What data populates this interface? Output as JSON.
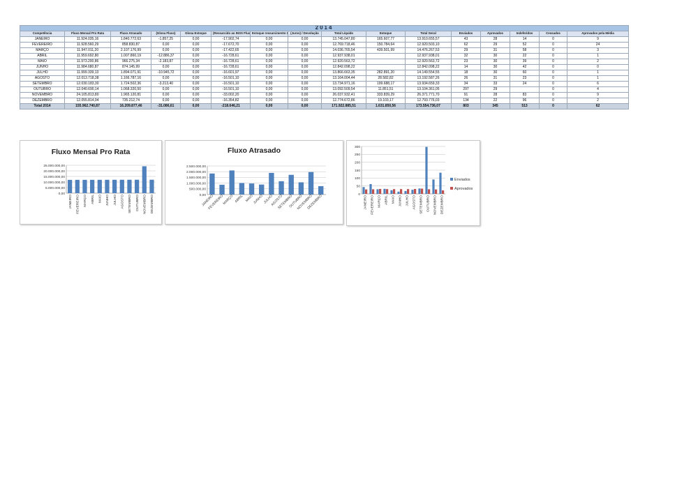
{
  "table": {
    "year": "2014",
    "headers": [
      "Competência",
      "Fluxo Mensal Pro Rata",
      "Fluxo Atrasado",
      "(Glosa Fluxo)",
      "Glosa Estoque",
      "(Ressarcido ao INSS Fluxo)",
      "Estoque ressarcimento INSS",
      "(Juros) / Devolução",
      "Total Líquido",
      "Estoque",
      "Total Geral",
      "Enviados",
      "Aprovados",
      "Indeferidos",
      "Cessados",
      "Aprovados pela Média"
    ],
    "rows": [
      [
        "JANEIRO",
        "11.924.035,16",
        "1.840.772,63",
        "-1.857,25",
        "0,00",
        "-17.902,74",
        "0,00",
        "0,00",
        "13.745.047,80",
        "165.607,77",
        "13.910.655,57",
        "43",
        "28",
        "14",
        "0",
        "9"
      ],
      [
        "FEVEREIRO",
        "11.928.560,29",
        "858.830,87",
        "0,00",
        "0,00",
        "-17.672,70",
        "0,00",
        "0,00",
        "12.769.718,46",
        "150.784,64",
        "12.920.503,10",
        "62",
        "29",
        "52",
        "0",
        "24"
      ],
      [
        "MARÇO",
        "11.947.011,20",
        "2.107.176,99",
        "0,00",
        "0,00",
        "-17.422,65",
        "0,00",
        "0,00",
        "14.036.765,54",
        "439.501,99",
        "14.476.267,53",
        "29",
        "31",
        "58",
        "0",
        "3"
      ],
      [
        "ABRIL",
        "11.959.692,80",
        "1.007.860,19",
        "-12.886,37",
        "0,00",
        "-16.728,61",
        "0,00",
        "0,00",
        "12.937.938,01",
        "",
        "12.937.938,01",
        "32",
        "30",
        "22",
        "0",
        "1"
      ],
      [
        "MAIO",
        "11.973.200,86",
        "966.275,34",
        "-2.183,87",
        "0,00",
        "-16.728,61",
        "0,00",
        "0,00",
        "12.920.563,72",
        "",
        "12.920.563,72",
        "23",
        "30",
        "39",
        "0",
        "2"
      ],
      [
        "JUNHO",
        "11.984.680,87",
        "874.145,99",
        "0,00",
        "0,00",
        "-16.728,61",
        "0,00",
        "0,00",
        "12.842.098,22",
        "",
        "12.842.098,22",
        "14",
        "30",
        "42",
        "0",
        "0"
      ],
      [
        "JULHO",
        "11.999.339,13",
        "1.894.071,91",
        "-10.945,72",
        "0,00",
        "-16.601,97",
        "0,00",
        "0,00",
        "13.866.663,35",
        "282.891,20",
        "14.149.554,55",
        "18",
        "30",
        "60",
        "0",
        "1"
      ],
      [
        "AGOSTO",
        "12.013.718,38",
        "1.166.787,16",
        "0,00",
        "0,00",
        "-16.501,10",
        "0,00",
        "0,00",
        "13.164.004,44",
        "28.582,82",
        "13.192.587,26",
        "26",
        "31",
        "23",
        "0",
        "1"
      ],
      [
        "SETEMBRO",
        "12.030.183,30",
        "1.724.502,36",
        "-3.213,40",
        "0,00",
        "-16.501,10",
        "0,00",
        "0,00",
        "13.734.971,16",
        "199.688,17",
        "13.934.659,33",
        "34",
        "33",
        "24",
        "0",
        "6"
      ],
      [
        "OUTUBRO",
        "12.040.690,14",
        "1.068.320,50",
        "0,00",
        "0,00",
        "-16.501,10",
        "0,00",
        "0,00",
        "13.092.509,54",
        "11.851,51",
        "13.104.361,05",
        "297",
        "29",
        "",
        "0",
        "4"
      ],
      [
        "NOVEMBRO",
        "24.105.813,80",
        "1.965.120,81",
        "0,00",
        "0,00",
        "-33.002,20",
        "0,00",
        "0,00",
        "26.037.932,41",
        "333.839,29",
        "26.371.771,70",
        "91",
        "28",
        "83",
        "0",
        "9"
      ],
      [
        "DEZEMBRO",
        "12.055.814,94",
        "735.212,74",
        "0,00",
        "0,00",
        "-16.354,82",
        "0,00",
        "0,00",
        "12.774.672,86",
        "19.103,17",
        "12.793.776,03",
        "134",
        "22",
        "96",
        "0",
        "2"
      ]
    ],
    "total": [
      "Total 2014",
      "155.962.740,87",
      "16.209.877,46",
      "-31.086,61",
      "0,00",
      "-218.646,21",
      "0,00",
      "0,00",
      "171.922.885,51",
      "1.631.850,56",
      "173.554.736,07",
      "803",
      "345",
      "513",
      "0",
      "62"
    ]
  },
  "months": [
    "JANEIRO",
    "FEVEREIRO",
    "MARÇO",
    "ABRIL",
    "MAIO",
    "JUNHO",
    "JULHO",
    "AGOSTO",
    "SETEMBRO",
    "OUTUBRO",
    "NOVEMBRO",
    "DEZEMBRO"
  ],
  "chart_data": [
    {
      "type": "bar",
      "title": "Fluxo Mensal Pro Rata",
      "categories": [
        "JANEIRO",
        "FEVEREIRO",
        "MARÇO",
        "ABRIL",
        "MAIO",
        "JUNHO",
        "JULHO",
        "AGOSTO",
        "SETEMBRO",
        "OUTUBRO",
        "NOVEMBRO",
        "DEZEMBRO"
      ],
      "values": [
        11924035.16,
        11928560.29,
        11947011.2,
        11959692.8,
        11973200.86,
        11984680.87,
        11999339.13,
        12013718.38,
        12030183.3,
        12040690.14,
        24105813.8,
        12055814.94
      ],
      "ylim": [
        0,
        25000000
      ],
      "yticks": [
        "0,00",
        "5.000.000,00",
        "10.000.000,00",
        "15.000.000,00",
        "20.000.000,00",
        "25.000.000,00"
      ],
      "color": "#4f81bd",
      "grid": true
    },
    {
      "type": "bar",
      "title": "Fluxo Atrasado",
      "categories": [
        "JANEIRO",
        "FEVEREIRO",
        "MARÇO",
        "ABRIL",
        "MAIO",
        "JUNHO",
        "JULHO",
        "AGOSTO",
        "SETEMBRO",
        "OUTUBRO",
        "NOVEMBRO",
        "DEZEMBRO"
      ],
      "values": [
        1840772.63,
        858830.87,
        2107176.99,
        1007860.19,
        966275.34,
        874145.99,
        1894071.91,
        1166787.16,
        1724502.36,
        1068320.5,
        1965120.81,
        735212.74
      ],
      "ylim": [
        0,
        2500000
      ],
      "yticks": [
        "0,00",
        "500.000,00",
        "1.000.000,00",
        "1.500.000,00",
        "2.000.000,00",
        "2.500.000,00"
      ],
      "color": "#4f81bd",
      "grid": true
    },
    {
      "type": "bar",
      "title": "",
      "categories": [
        "JANEIRO",
        "FEVEREIRO",
        "MARÇO",
        "ABRIL",
        "MAIO",
        "JUNHO",
        "JULHO",
        "AGOSTO",
        "SETEMBRO",
        "OUTUBRO",
        "NOVEMBRO",
        "DEZEMBRO"
      ],
      "series": [
        {
          "name": "Enviados",
          "values": [
            43,
            62,
            29,
            32,
            23,
            14,
            18,
            26,
            34,
            297,
            91,
            134
          ],
          "color": "#4f81bd"
        },
        {
          "name": "Aprovados",
          "values": [
            28,
            29,
            31,
            30,
            30,
            30,
            30,
            31,
            33,
            29,
            28,
            22
          ],
          "color": "#c0504d"
        }
      ],
      "ylim": [
        0,
        300
      ],
      "yticks": [
        "0",
        "50",
        "100",
        "150",
        "200",
        "250",
        "300"
      ],
      "legend": "right",
      "grid": true
    }
  ]
}
